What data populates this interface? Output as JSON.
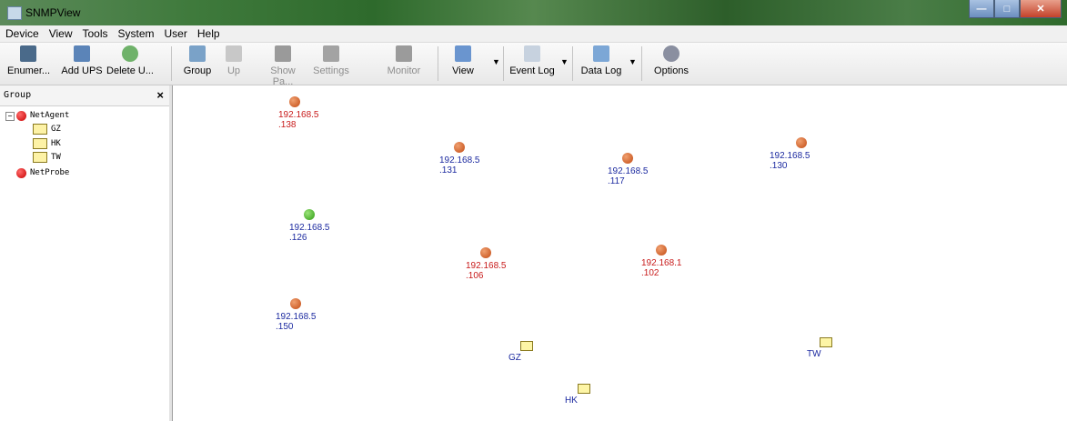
{
  "window": {
    "title": "SNMPView"
  },
  "menu": [
    "Device",
    "View",
    "Tools",
    "System",
    "User",
    "Help"
  ],
  "toolbar": {
    "enumerate": "Enumer...",
    "add_ups": "Add UPS",
    "delete_ups": "Delete U...",
    "group": "Group",
    "up": "Up",
    "show_panel": "Show Pa...",
    "settings": "Settings",
    "monitor": "Monitor",
    "view": "View",
    "event_log": "Event Log",
    "data_log": "Data Log",
    "options": "Options"
  },
  "panel": {
    "title": "Group",
    "tree": {
      "netagent": "NetAgent",
      "gz": "GZ",
      "hk": "HK",
      "tw": "TW",
      "netprobe": "NetProbe"
    }
  },
  "devices": [
    {
      "line1": "192.168.5",
      "line2": ".138",
      "status": "orange",
      "text": "red"
    },
    {
      "line1": "192.168.5",
      "line2": ".131",
      "status": "orange",
      "text": "blue"
    },
    {
      "line1": "192.168.5",
      "line2": ".117",
      "status": "orange",
      "text": "blue"
    },
    {
      "line1": "192.168.5",
      "line2": ".130",
      "status": "orange",
      "text": "blue"
    },
    {
      "line1": "192.168.5",
      "line2": ".126",
      "status": "green",
      "text": "blue"
    },
    {
      "line1": "192.168.5",
      "line2": ".106",
      "status": "orange",
      "text": "red"
    },
    {
      "line1": "192.168.1",
      "line2": ".102",
      "status": "orange",
      "text": "red"
    },
    {
      "line1": "192.168.5",
      "line2": ".150",
      "status": "orange",
      "text": "blue"
    }
  ],
  "groups": [
    "GZ",
    "TW",
    "HK"
  ],
  "colors": {
    "device_red_text": "#c81a1a",
    "device_blue_text": "#1c2aa0",
    "status_orange": "#c24a12",
    "status_green": "#2c9a10"
  }
}
